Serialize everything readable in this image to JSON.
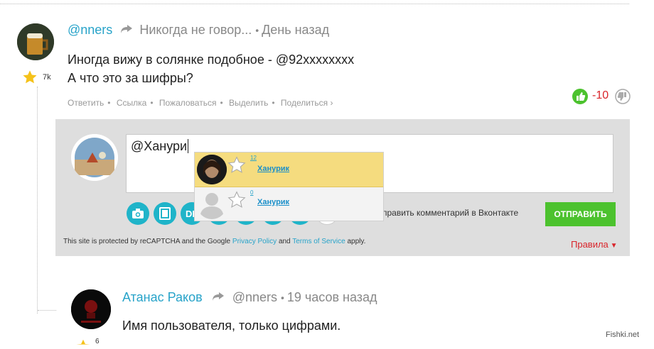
{
  "comment1": {
    "author": "@nners",
    "reply_to": "Никогда не говор...",
    "time": "День назад",
    "rating": "7k",
    "lines": [
      "Иногда вижу в солянке подобное - @92xxxxxxxx",
      "А что это за шифры?"
    ],
    "actions": [
      "Ответить",
      "Ссылка",
      "Пожаловаться",
      "Выделить",
      "Поделиться"
    ],
    "score": "-10"
  },
  "reply_form": {
    "input_value": "@Ханури",
    "toolbar_partial_label": "DE",
    "vk_label": "править комментарий в Вконтакте",
    "submit_label": "ОТПРАВИТЬ",
    "recaptcha": {
      "prefix": "This site is protected by reCAPTCHA and the Google",
      "privacy": "Privacy Policy",
      "and": "and",
      "terms": "Terms of Service",
      "suffix": "apply."
    },
    "rules_label": "Правила"
  },
  "mentions": [
    {
      "count": "12",
      "name": "Ханурик",
      "highlighted": true
    },
    {
      "count": "0",
      "name": "Ханурик",
      "highlighted": false
    }
  ],
  "comment2": {
    "author": "Атанас Раков",
    "reply_to": "@nners",
    "time": "19 часов назад",
    "text": "Имя пользователя, только цифрами.",
    "rating_partial": "6"
  },
  "watermark": "Fishki.net",
  "colors": {
    "accent": "#27a3c9",
    "submit": "#4cc22e",
    "negative": "#d9242a",
    "highlight": "#f5dc7f"
  }
}
